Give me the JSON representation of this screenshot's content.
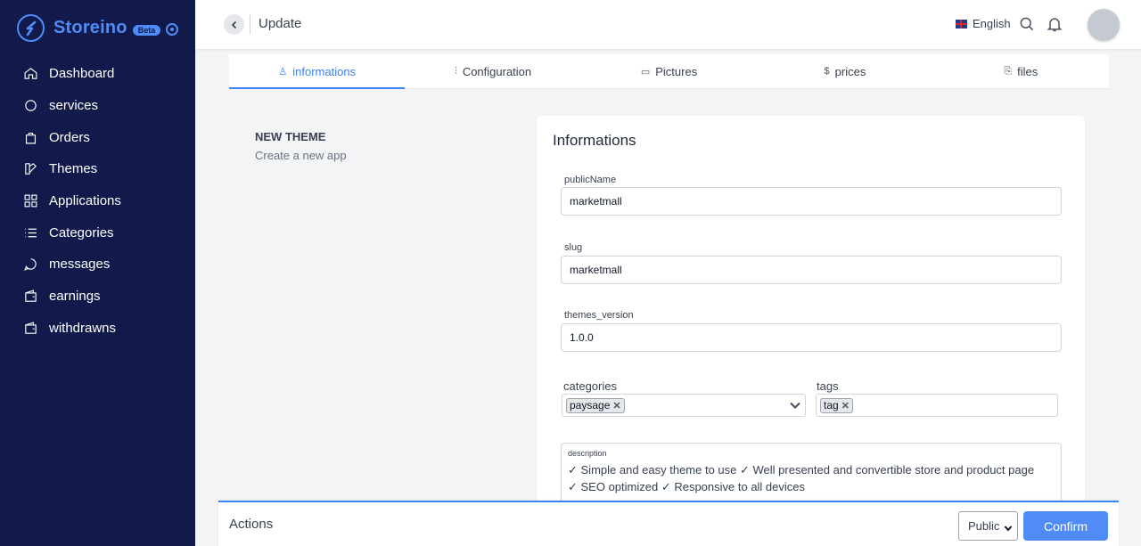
{
  "brand": {
    "name": "Storeino",
    "badge": "Beta"
  },
  "sidebar": {
    "items": [
      {
        "label": "Dashboard",
        "icon": "home-icon"
      },
      {
        "label": "services",
        "icon": "circle-icon"
      },
      {
        "label": "Orders",
        "icon": "bag-icon"
      },
      {
        "label": "Themes",
        "icon": "theme-icon"
      },
      {
        "label": "Applications",
        "icon": "grid-icon"
      },
      {
        "label": "Categories",
        "icon": "list-icon"
      },
      {
        "label": "messages",
        "icon": "chat-icon"
      },
      {
        "label": "earnings",
        "icon": "wallet-icon"
      },
      {
        "label": "withdrawns",
        "icon": "wallet-icon"
      }
    ]
  },
  "header": {
    "title": "Update",
    "language": "English"
  },
  "tabs": [
    {
      "label": "informations",
      "icon": "user-icon",
      "glyph": "♙"
    },
    {
      "label": "Configuration",
      "icon": "sliders-icon",
      "glyph": "⫶"
    },
    {
      "label": "Pictures",
      "icon": "image-icon",
      "glyph": "▭"
    },
    {
      "label": "prices",
      "icon": "dollar-icon",
      "glyph": "$"
    },
    {
      "label": "files",
      "icon": "file-icon",
      "glyph": "⎘"
    }
  ],
  "section": {
    "title": "NEW THEME",
    "subtitle": "Create a new app"
  },
  "form": {
    "title": "Informations",
    "publicName": {
      "label": "publicName",
      "value": "marketmall"
    },
    "slug": {
      "label": "slug",
      "value": "marketmall"
    },
    "version": {
      "label": "themes_version",
      "value": "1.0.0"
    },
    "categories": {
      "label": "categories",
      "chips": [
        "paysage"
      ]
    },
    "tags": {
      "label": "tags",
      "chips": [
        "tag"
      ]
    },
    "description": {
      "label": "description",
      "line1": "✓ Simple and easy theme to use ✓ Well presented and convertible store and product page",
      "line2": "✓ SEO optimized ✓ Responsive to all devices"
    }
  },
  "actions": {
    "label": "Actions",
    "visibility": "Public",
    "confirm": "Confirm"
  },
  "colors": {
    "sidebar": "#111a4b",
    "accent": "#4f8cf7",
    "active_tab": "#3b82f6"
  }
}
